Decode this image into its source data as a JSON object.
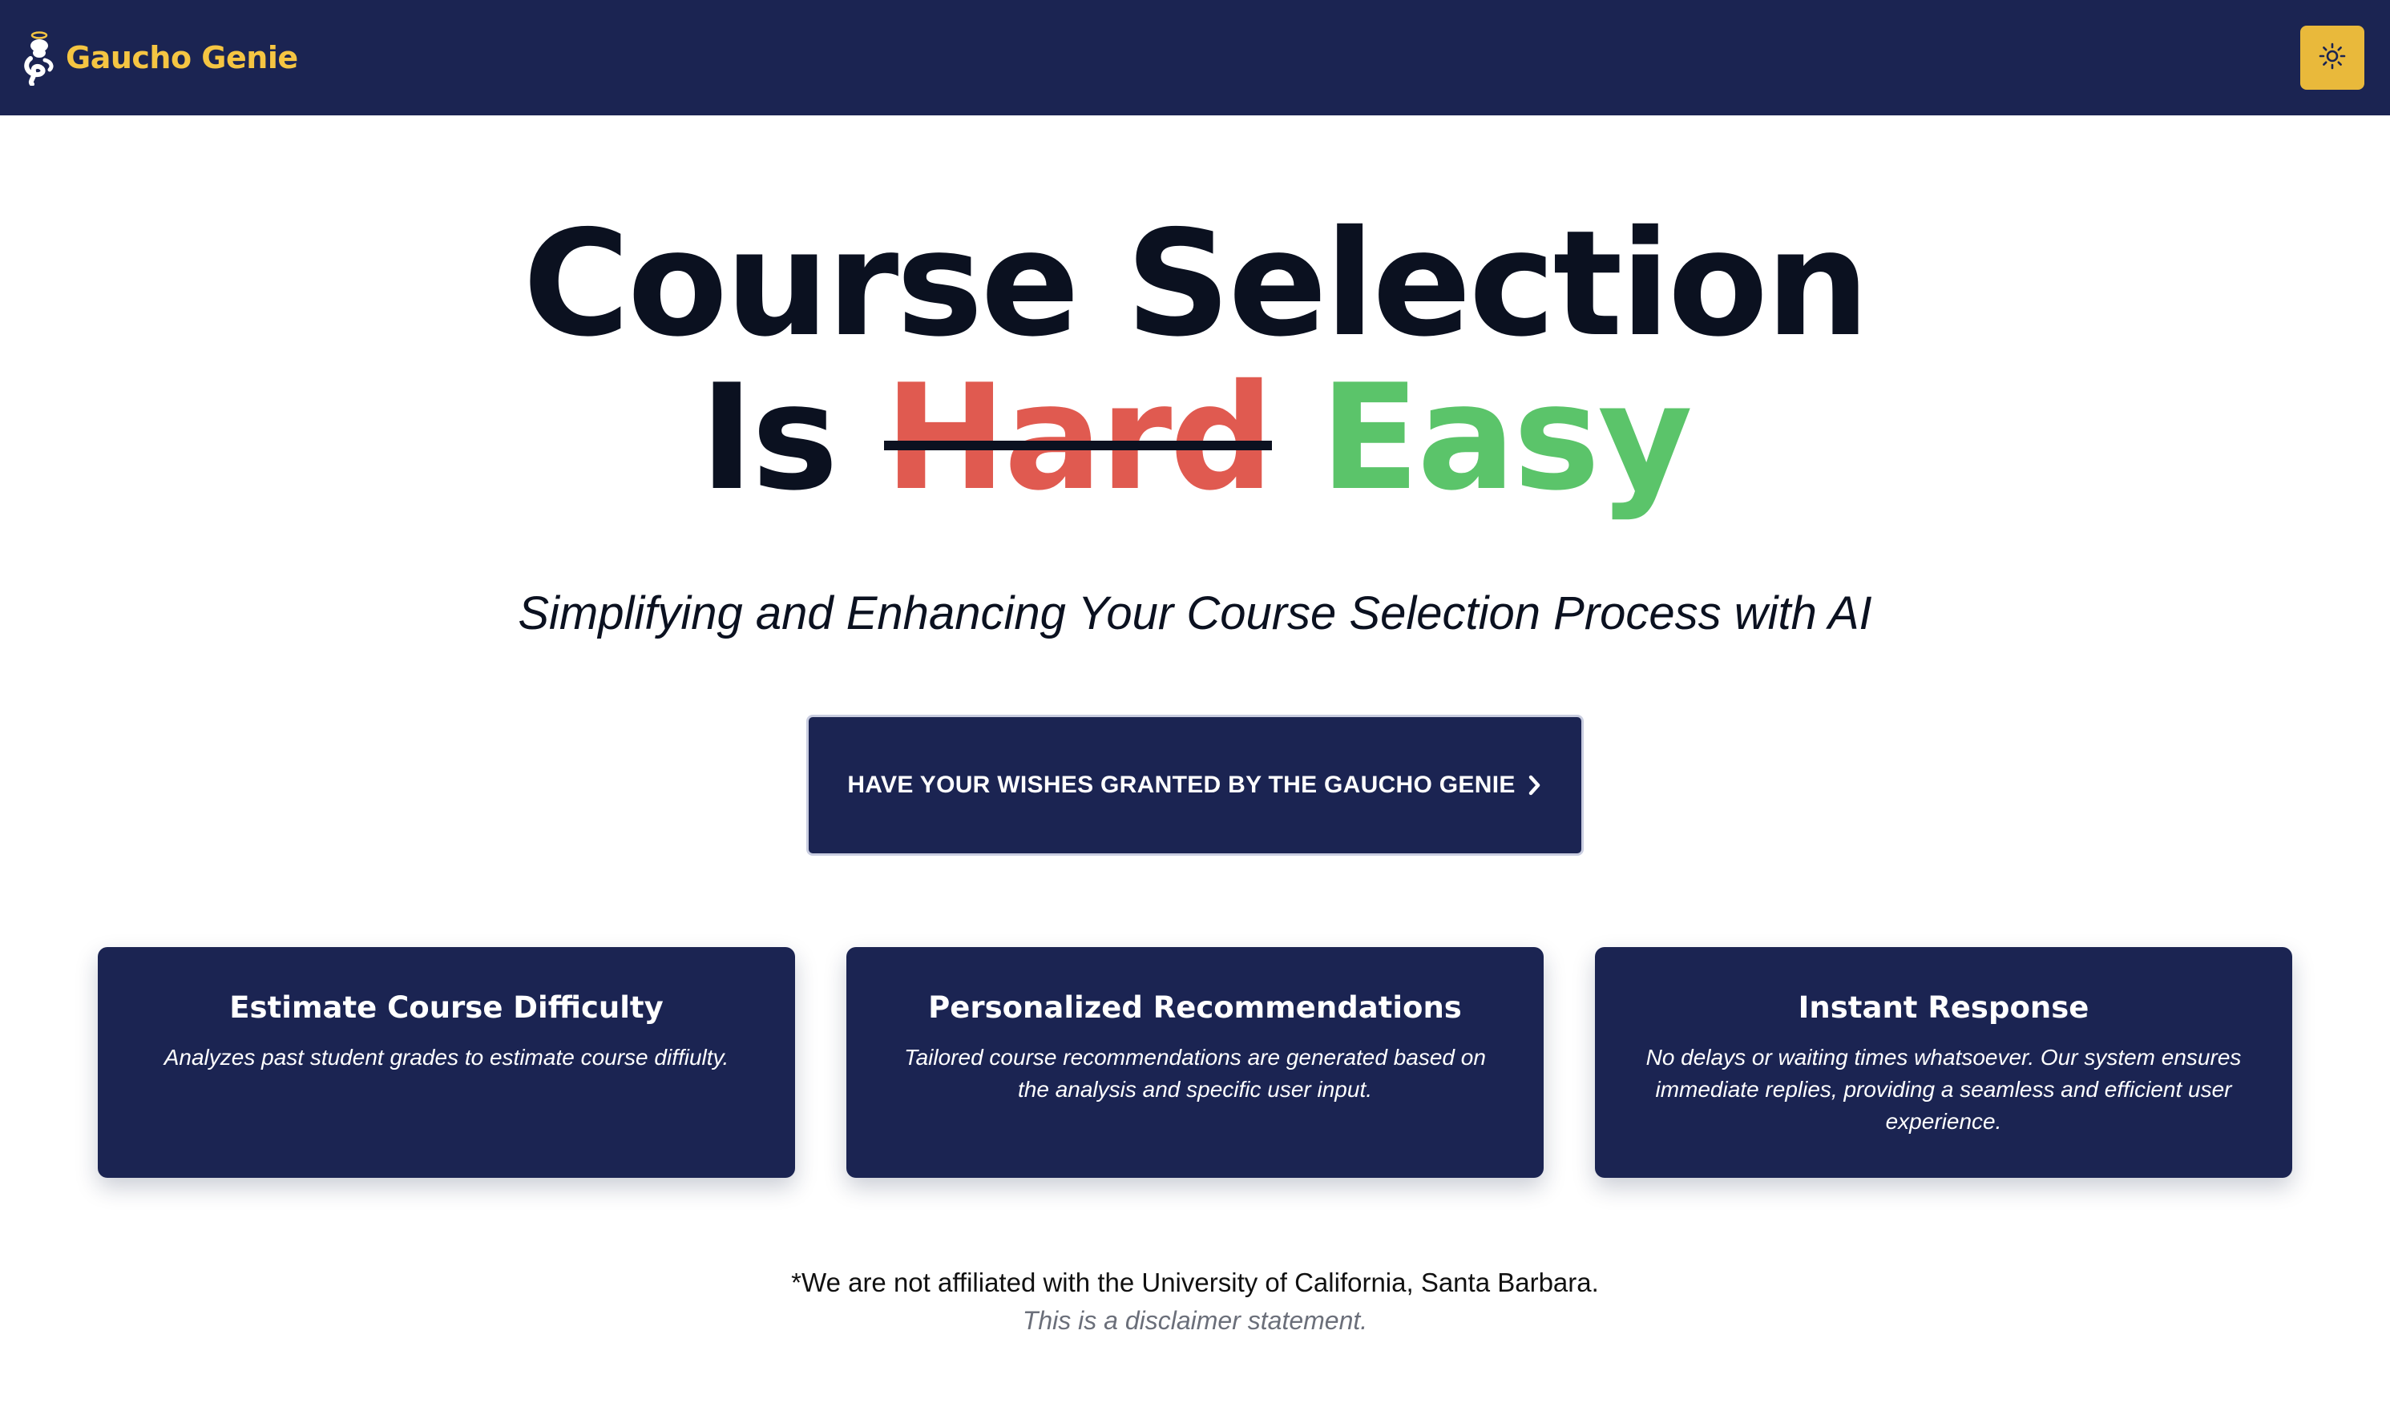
{
  "header": {
    "brand_name": "Gaucho Genie",
    "logo_icon": "genie-icon",
    "theme_toggle_icon": "sun-icon"
  },
  "hero": {
    "title_line1": "Course Selection",
    "title_is": "Is",
    "title_struck": "Hard",
    "title_replacement": "Easy",
    "subtitle": "Simplifying and Enhancing Your Course Selection Process with AI"
  },
  "cta": {
    "label": "HAVE YOUR WISHES GRANTED BY THE GAUCHO GENIE",
    "icon": "chevron-right-icon"
  },
  "features": [
    {
      "title": "Estimate Course Difficulty",
      "description": "Analyzes past student grades to estimate course diffiulty."
    },
    {
      "title": "Personalized Recommendations",
      "description": "Tailored course recommendations are generated based on the analysis and specific user input."
    },
    {
      "title": "Instant Response",
      "description": "No delays or waiting times whatsoever. Our system ensures immediate replies, providing a seamless and efficient user experience."
    }
  ],
  "footer": {
    "disclaimer": "*We are not affiliated with the University of California, Santa Barbara.",
    "note": "This is a disclaimer statement."
  },
  "colors": {
    "navy": "#1b2452",
    "brand_gold": "#f5c542",
    "toggle_gold": "#e9b93b",
    "hard_red": "#e05a50",
    "easy_green": "#5bc46a"
  }
}
